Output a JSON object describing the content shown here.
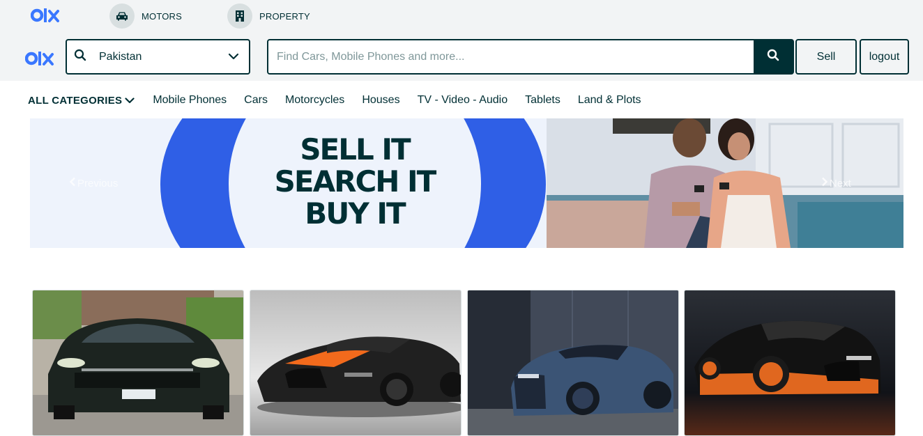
{
  "header": {
    "verticals": [
      {
        "label": "MOTORS",
        "icon": "car-icon"
      },
      {
        "label": "PROPERTY",
        "icon": "building-icon"
      }
    ],
    "location": {
      "value": "Pakistan"
    },
    "search": {
      "placeholder": "Find Cars, Mobile Phones and more..."
    },
    "sell_label": "Sell",
    "logout_label": "logout"
  },
  "categories": {
    "all_label": "ALL CATEGORIES",
    "items": [
      "Mobile Phones",
      "Cars",
      "Motorcycles",
      "Houses",
      "TV - Video - Audio",
      "Tablets",
      "Land & Plots"
    ]
  },
  "banner": {
    "slogan": [
      "SELL IT",
      "SEARCH IT",
      "BUY IT"
    ],
    "prev_label": "Previous",
    "next_label": "Next"
  },
  "listings": [
    {
      "alt": "car-photo-toyota-pickup"
    },
    {
      "alt": "car-photo-bugatti-black-orange"
    },
    {
      "alt": "car-photo-bugatti-blue"
    },
    {
      "alt": "car-photo-bugatti-orange-black"
    }
  ],
  "colors": {
    "brand_dark": "#002f34",
    "brand_blue": "#2f5fe6",
    "logo_blue": "#3a77ff"
  }
}
